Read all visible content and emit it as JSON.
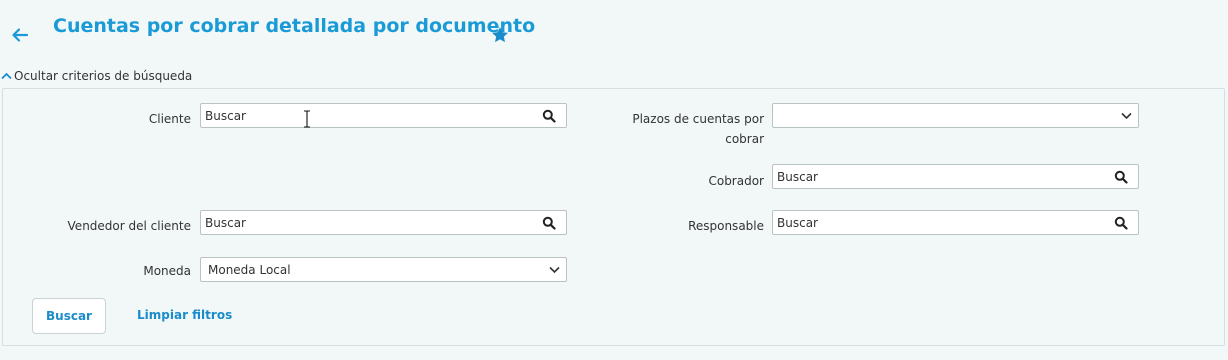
{
  "header": {
    "title": "Cuentas por cobrar detallada por documento",
    "back_icon": "arrow-left-icon",
    "favorite_icon": "star-icon"
  },
  "toggle": {
    "label": "Ocultar criterios de búsqueda"
  },
  "filters": {
    "cliente": {
      "label": "Cliente",
      "value": "Buscar"
    },
    "plazos": {
      "label_line1": "Plazos de cuentas por",
      "label_line2": "cobrar",
      "value": ""
    },
    "cobrador": {
      "label": "Cobrador",
      "value": "Buscar"
    },
    "vendedor": {
      "label": "Vendedor del cliente",
      "value": "Buscar"
    },
    "responsable": {
      "label": "Responsable",
      "value": "Buscar"
    },
    "moneda": {
      "label": "Moneda",
      "value": "Moneda Local"
    }
  },
  "actions": {
    "search_label": "Buscar",
    "clear_label": "Limpiar filtros"
  },
  "colors": {
    "accent": "#1a9ad6",
    "background": "#f2f8f8",
    "border": "#b9c3c4"
  }
}
